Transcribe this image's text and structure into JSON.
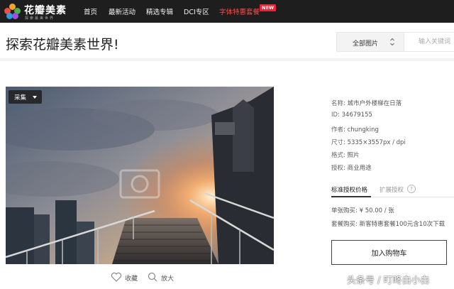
{
  "nav": {
    "logo_text": "花瓣美素",
    "logo_subtext": "探索最美世界",
    "items": [
      {
        "label": "首页"
      },
      {
        "label": "最新活动"
      },
      {
        "label": "精选专辑"
      },
      {
        "label": "DCI专区"
      },
      {
        "label": "字体特惠套餐",
        "badge": "NEW"
      }
    ]
  },
  "header": {
    "title": "探索花瓣美素世界!",
    "filter_value": "全部图片",
    "search_placeholder": "输入关键词"
  },
  "photo": {
    "collect_label": "采集",
    "favorite_label": "收藏",
    "zoom_label": "放大"
  },
  "details": {
    "name": {
      "label": "名称:",
      "value": "城市户外楼梯在日落"
    },
    "id": {
      "label": "ID:",
      "value": "34679155"
    },
    "author": {
      "label": "作者:",
      "value": "chungking"
    },
    "size": {
      "label": "尺寸:",
      "value": "5335×3557px / dpi"
    },
    "format": {
      "label": "格式:",
      "value": "照片"
    },
    "license": {
      "label": "授权:",
      "value": "商业用途"
    }
  },
  "tabs": [
    {
      "label": "标准授权价格",
      "active": true
    },
    {
      "label": "扩展授权",
      "active": false
    }
  ],
  "pricing": {
    "single": {
      "label": "单张购买:",
      "value": "¥ 50.00 / 张"
    },
    "bundle": {
      "label": "套餐购买:",
      "value": "新客特惠套餐100元含10次下载"
    }
  },
  "cart_button": "加入购物车",
  "watermark": "头条号 / 叮咚白小白",
  "colors": {
    "nav_bg": "#1e1e1e",
    "hot_link": "#ff4a4a",
    "new_badge": "#e8263a"
  }
}
